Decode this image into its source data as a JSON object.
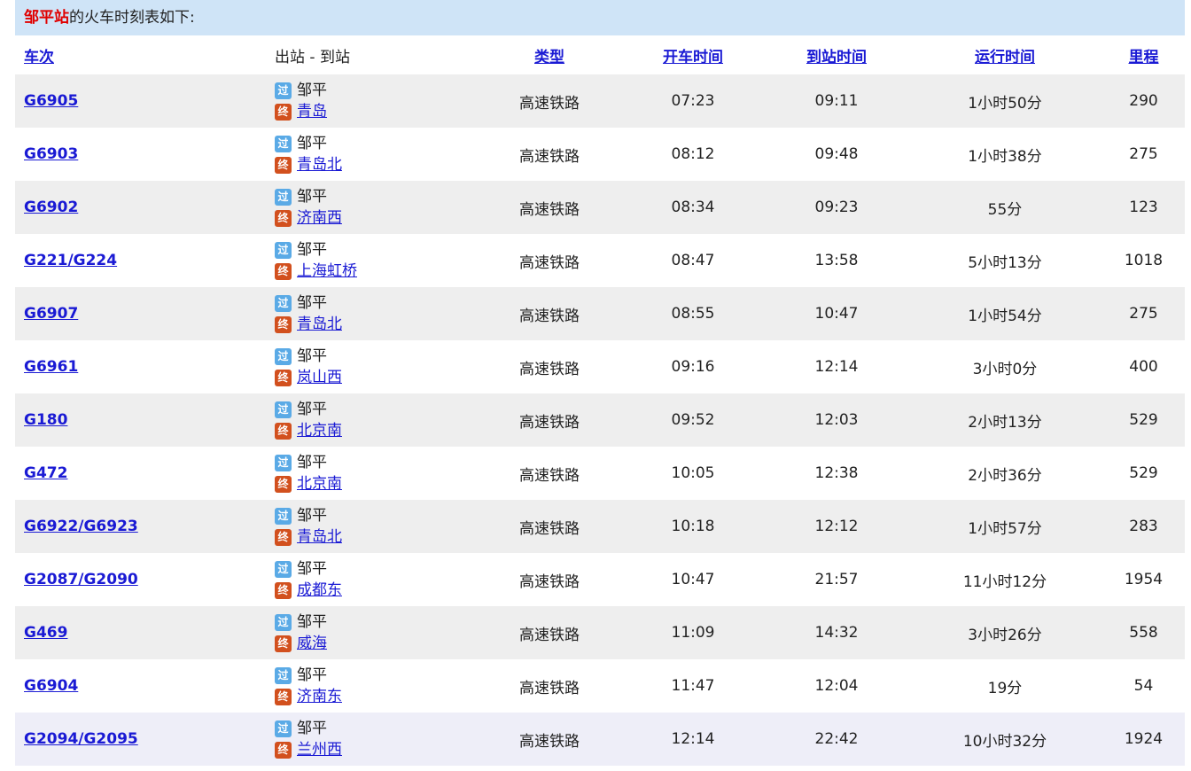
{
  "caption": {
    "station": "邹平站",
    "suffix": "的火车时刻表如下:"
  },
  "headers": {
    "train": "车次",
    "route": "出站 - 到站",
    "type": "类型",
    "depart": "开车时间",
    "arrive": "到站时间",
    "duration": "运行时间",
    "distance": "里程"
  },
  "badges": {
    "pass": "过",
    "end": "终"
  },
  "colors": {
    "link": "#1a1ad4",
    "station_highlight": "#e00000",
    "caption_bg": "#cfe4f7",
    "pass_badge": "#5aaae6",
    "end_badge": "#d2501e"
  },
  "rows": [
    {
      "train": "G6905",
      "from": "邹平",
      "to": "青岛",
      "type": "高速铁路",
      "depart": "07:23",
      "arrive": "09:11",
      "duration": "1小时50分",
      "distance": "290"
    },
    {
      "train": "G6903",
      "from": "邹平",
      "to": "青岛北",
      "type": "高速铁路",
      "depart": "08:12",
      "arrive": "09:48",
      "duration": "1小时38分",
      "distance": "275"
    },
    {
      "train": "G6902",
      "from": "邹平",
      "to": "济南西",
      "type": "高速铁路",
      "depart": "08:34",
      "arrive": "09:23",
      "duration": "55分",
      "distance": "123"
    },
    {
      "train": "G221/G224",
      "from": "邹平",
      "to": "上海虹桥",
      "type": "高速铁路",
      "depart": "08:47",
      "arrive": "13:58",
      "duration": "5小时13分",
      "distance": "1018"
    },
    {
      "train": "G6907",
      "from": "邹平",
      "to": "青岛北",
      "type": "高速铁路",
      "depart": "08:55",
      "arrive": "10:47",
      "duration": "1小时54分",
      "distance": "275"
    },
    {
      "train": "G6961",
      "from": "邹平",
      "to": "岚山西",
      "type": "高速铁路",
      "depart": "09:16",
      "arrive": "12:14",
      "duration": "3小时0分",
      "distance": "400"
    },
    {
      "train": "G180",
      "from": "邹平",
      "to": "北京南",
      "type": "高速铁路",
      "depart": "09:52",
      "arrive": "12:03",
      "duration": "2小时13分",
      "distance": "529"
    },
    {
      "train": "G472",
      "from": "邹平",
      "to": "北京南",
      "type": "高速铁路",
      "depart": "10:05",
      "arrive": "12:38",
      "duration": "2小时36分",
      "distance": "529"
    },
    {
      "train": "G6922/G6923",
      "from": "邹平",
      "to": "青岛北",
      "type": "高速铁路",
      "depart": "10:18",
      "arrive": "12:12",
      "duration": "1小时57分",
      "distance": "283"
    },
    {
      "train": "G2087/G2090",
      "from": "邹平",
      "to": "成都东",
      "type": "高速铁路",
      "depart": "10:47",
      "arrive": "21:57",
      "duration": "11小时12分",
      "distance": "1954"
    },
    {
      "train": "G469",
      "from": "邹平",
      "to": "威海",
      "type": "高速铁路",
      "depart": "11:09",
      "arrive": "14:32",
      "duration": "3小时26分",
      "distance": "558"
    },
    {
      "train": "G6904",
      "from": "邹平",
      "to": "济南东",
      "type": "高速铁路",
      "depart": "11:47",
      "arrive": "12:04",
      "duration": "19分",
      "distance": "54"
    },
    {
      "train": "G2094/G2095",
      "from": "邹平",
      "to": "兰州西",
      "type": "高速铁路",
      "depart": "12:14",
      "arrive": "22:42",
      "duration": "10小时32分",
      "distance": "1924"
    }
  ]
}
